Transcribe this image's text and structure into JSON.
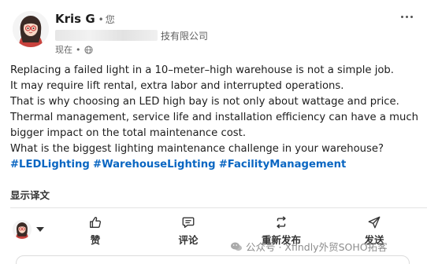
{
  "author": {
    "name": "Kris G",
    "connection": "您",
    "subtitle_visible": "技有限公司",
    "time": "现在",
    "avatar_icon": "cartoon-woman-avatar"
  },
  "post": {
    "lines": [
      "Replacing a failed light in a 10–meter–high warehouse is not a simple job.",
      "It may require lift rental, extra labor and interrupted operations.",
      "That is why choosing an LED high bay is not only about wattage and price.",
      "Thermal management, service life and installation efficiency can have a much",
      "bigger impact on the total maintenance cost.",
      "What is the biggest lighting maintenance challenge in your warehouse?"
    ],
    "hashtags": [
      "#LEDLighting",
      "#WarehouseLighting",
      "#FacilityManagement"
    ]
  },
  "translate_label": "显示译文",
  "actions": {
    "like": "赞",
    "comment": "评论",
    "repost": "重新发布",
    "send": "发送"
  },
  "watermark": "公众号 · Xfindly外贸SOHO拓客",
  "colors": {
    "hashtag": "#0a66c2",
    "text": "#1d1d1d"
  }
}
